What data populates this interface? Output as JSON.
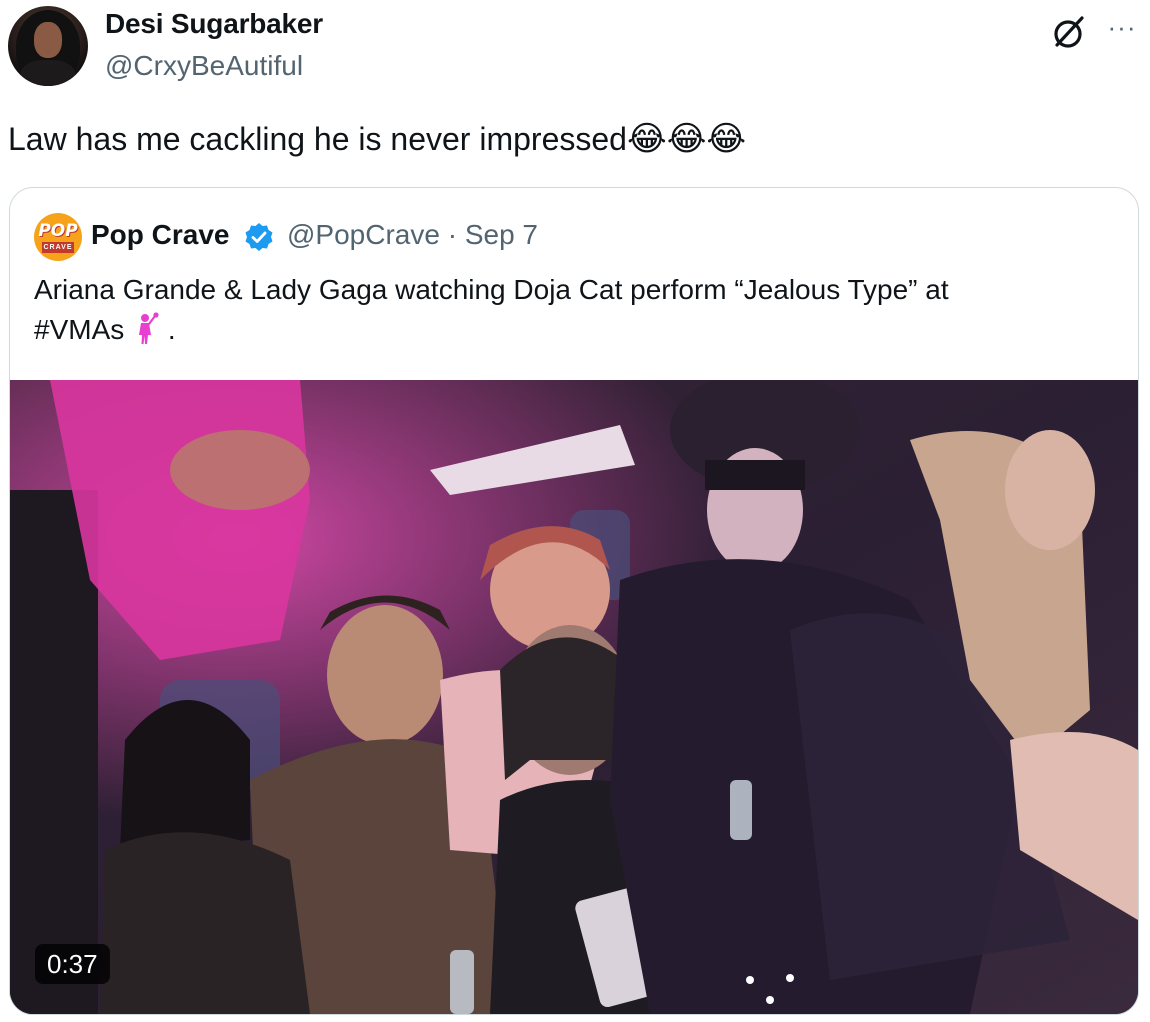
{
  "author": {
    "name": "Desi Sugarbaker",
    "handle": "@CrxyBeAutiful",
    "avatar_icon": "user-avatar"
  },
  "tweet": {
    "text": "Law has me cackling he is never impressed",
    "emojis": [
      "😂",
      "😂",
      "😂"
    ]
  },
  "header_icons": {
    "grok": "grok-slash-circle-icon",
    "more": "···"
  },
  "quoted": {
    "name": "Pop Crave",
    "avatar_icon": "pop-crave-logo",
    "logo_text_top": "POP",
    "logo_text_bottom": "CRAVE",
    "verified_color": "#1d9bf0",
    "handle": "@PopCrave",
    "separator": "·",
    "date": "Sep 7",
    "text_line1": "Ariana Grande & Lady Gaga watching Doja Cat perform “Jealous Type” at",
    "text_line2_prefix": "#VMAs",
    "text_line2_suffix": ".",
    "inline_icon": "singer-microphone-icon",
    "media": {
      "type": "video",
      "duration": "0:37"
    }
  },
  "colors": {
    "primary_text": "#0f1419",
    "secondary_text": "#536471",
    "border": "#cfd9de",
    "accent_pink": "#e83fd1"
  }
}
